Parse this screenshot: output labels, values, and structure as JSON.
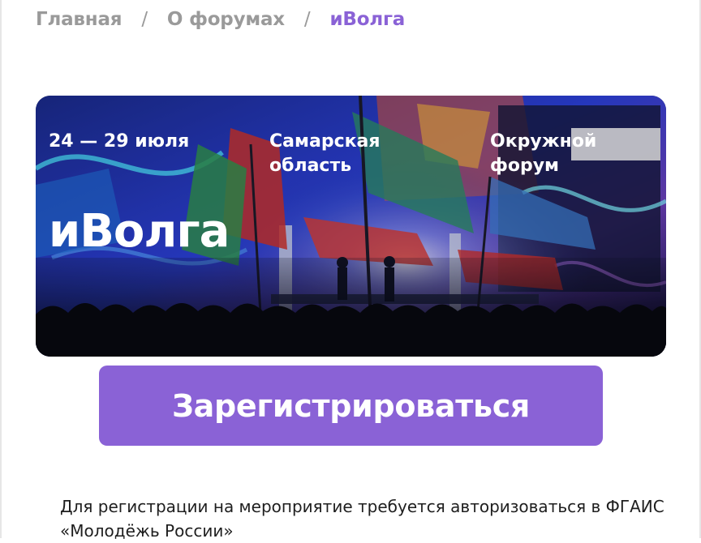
{
  "breadcrumb": {
    "items": [
      {
        "label": "Главная"
      },
      {
        "label": "О форумах"
      },
      {
        "label": "иВолга"
      }
    ],
    "separator": "/"
  },
  "banner": {
    "dates": "24 — 29 июля",
    "region": "Самарская область",
    "type": "Окружной форум",
    "title": "иВолга"
  },
  "register": {
    "label": "Зарегистрироваться"
  },
  "note": {
    "text": "Для регистрации на мероприятие требуется авторизоваться в ФГАИС «Молодёжь России»"
  },
  "colors": {
    "accent": "#8a62d6",
    "breadcrumb_muted": "#9a9a9a",
    "text": "#1e1e1e"
  }
}
